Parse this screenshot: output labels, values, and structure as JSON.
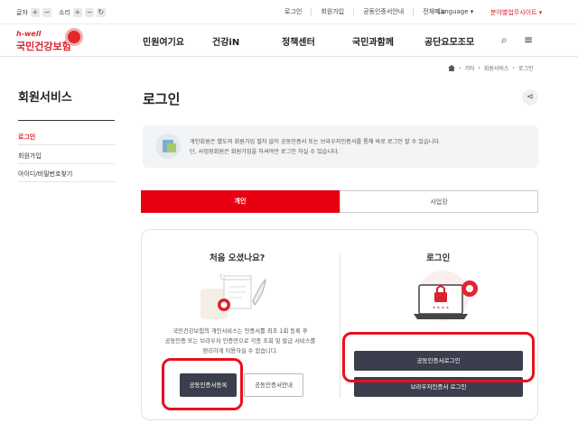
{
  "util": {
    "font_label": "글자",
    "sound_label": "소리",
    "plus": "+",
    "minus": "−",
    "reset": "↻",
    "links": [
      "로그인",
      "회원가입",
      "공동인증서안내",
      "전체메뉴"
    ],
    "language": "Language ▾",
    "partner": "분야별업무사이트 ▾"
  },
  "logo": {
    "hwell": "h-well",
    "name": "국민건강보험"
  },
  "gnb": [
    "민원여기요",
    "건강iN",
    "정책센터",
    "국민과함께",
    "공단요모조모"
  ],
  "icons": {
    "search": "⌕",
    "menu": "≡",
    "share": "⋖"
  },
  "breadcrumb": [
    "기타",
    "회원서비스",
    "로그인"
  ],
  "snb": {
    "title": "회원서비스",
    "items": [
      "로그인",
      "회원가입",
      "아이디/비밀번호찾기"
    ]
  },
  "page_title": "로그인",
  "notice": {
    "line1": "개인회원은 별도의 회원가입 절차 없이 공동인증서 또는 브라우저인증서를 통해 바로 로그인 할 수 있습니다.",
    "line2": "단, 사업장회원은 회원가입을 하셔야만 로그인 하실 수 있습니다."
  },
  "tabs": {
    "personal": "개인",
    "business": "사업장"
  },
  "first_visit": {
    "title": "처음 오셨나요?",
    "desc1": "국민건강보험의 개인서비스는 인증서를 최초 1회 등록 후",
    "desc2": "공동인증 또는 브라우저 인증만으로 각종 조회 및 발급 서비스를",
    "desc3": "편리하게 이용하실 수 있습니다.",
    "register_btn": "공동인증서등록",
    "guide_btn": "공동인증서안내"
  },
  "login": {
    "title": "로그인",
    "pki_btn": "공동인증서로그인",
    "browser_btn": "브라우저인증서 로그인",
    "password_mask": "* * * *"
  },
  "colors": {
    "accent": "#e60012",
    "dark_button": "#3b3e4d",
    "highlight": "#e8101f"
  }
}
